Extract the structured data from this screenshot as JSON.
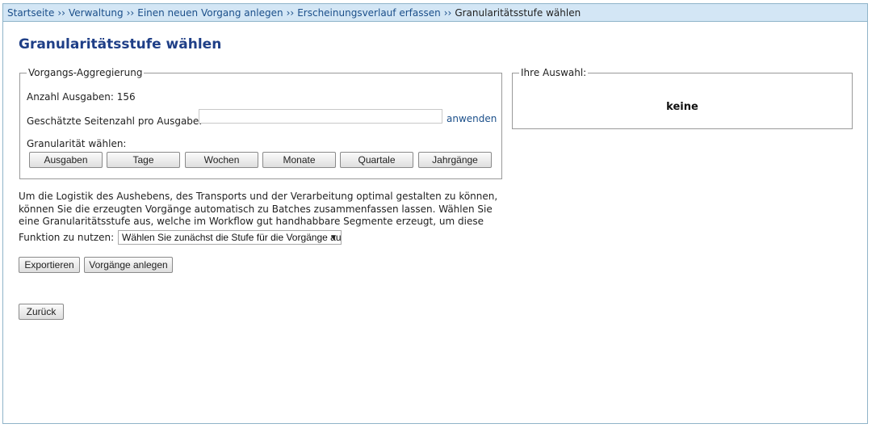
{
  "breadcrumb": {
    "items": [
      "Startseite",
      "Verwaltung",
      "Einen neuen Vorgang anlegen",
      "Erscheinungsverlauf erfassen"
    ],
    "current": "Granularitätsstufe wählen",
    "separator": "››"
  },
  "page_title": "Granularitätsstufe wählen",
  "aggregation": {
    "legend": "Vorgangs-Aggregierung",
    "issues_count_label": "Anzahl Ausgaben: 156",
    "pages_label": "Geschätzte Seitenzahl pro Ausgabe:",
    "pages_value": "",
    "apply_label": "anwenden",
    "granularity_label": "Granularität wählen:",
    "buttons": [
      "Ausgaben",
      "Tage",
      "Wochen",
      "Monate",
      "Quartale",
      "Jahrgänge"
    ]
  },
  "selection": {
    "legend": "Ihre Auswahl:",
    "value": "keine"
  },
  "description": {
    "lines": [
      "Um die Logistik des Aushebens, des Transports und der Verarbeitung optimal gestalten zu können,",
      "können Sie die erzeugten Vorgänge automatisch zu Batches zusammenfassen lassen. Wählen Sie",
      "eine Granularitätsstufe aus, welche im Workflow gut handhabbare Segmente erzeugt, um diese"
    ],
    "function_label": "Funktion zu nutzen:",
    "select_value": "Wählen Sie zunächst die Stufe für die Vorgänge aus!"
  },
  "actions": {
    "export_label": "Exportieren",
    "create_label": "Vorgänge anlegen",
    "back_label": "Zurück"
  },
  "colors": {
    "breadcrumb_bg": "#d3e6f5",
    "title": "#1f3f87",
    "link": "#1b4f8a"
  }
}
